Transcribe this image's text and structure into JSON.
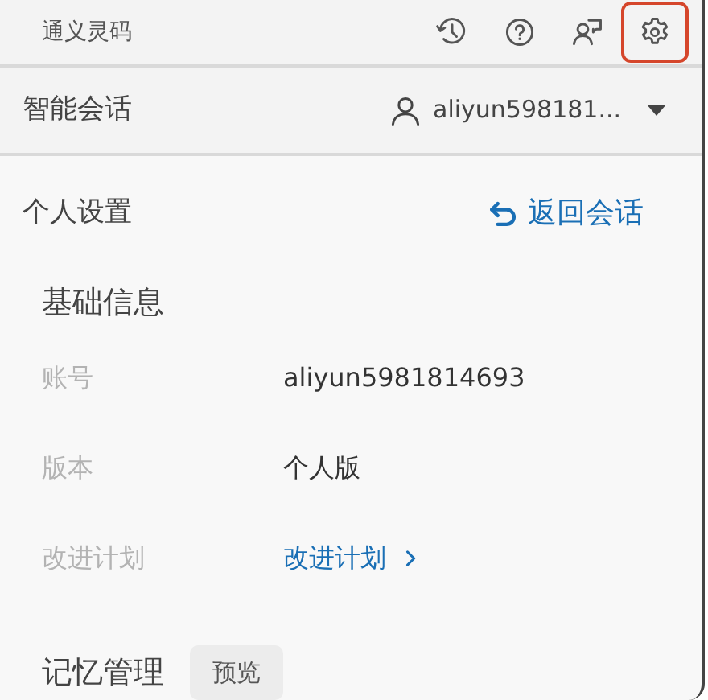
{
  "header": {
    "title": "通义灵码",
    "toolbar": [
      {
        "kind": "history",
        "highlighted": false
      },
      {
        "kind": "help",
        "highlighted": false
      },
      {
        "kind": "feedback",
        "highlighted": false
      },
      {
        "kind": "settings",
        "highlighted": true
      }
    ]
  },
  "session_bar": {
    "title": "智能会话",
    "user": "aliyun598181..."
  },
  "settings": {
    "title": "个人设置",
    "back_link": "返回会话",
    "sections": [
      {
        "title": "基础信息",
        "rows": [
          {
            "label": "账号",
            "value": "aliyun5981814693",
            "kind": "text"
          },
          {
            "label": "版本",
            "value": "个人版",
            "kind": "text"
          },
          {
            "label": "改进计划",
            "value": "改进计划",
            "kind": "link"
          }
        ]
      },
      {
        "title": "记忆管理",
        "badge": "预览"
      }
    ]
  }
}
